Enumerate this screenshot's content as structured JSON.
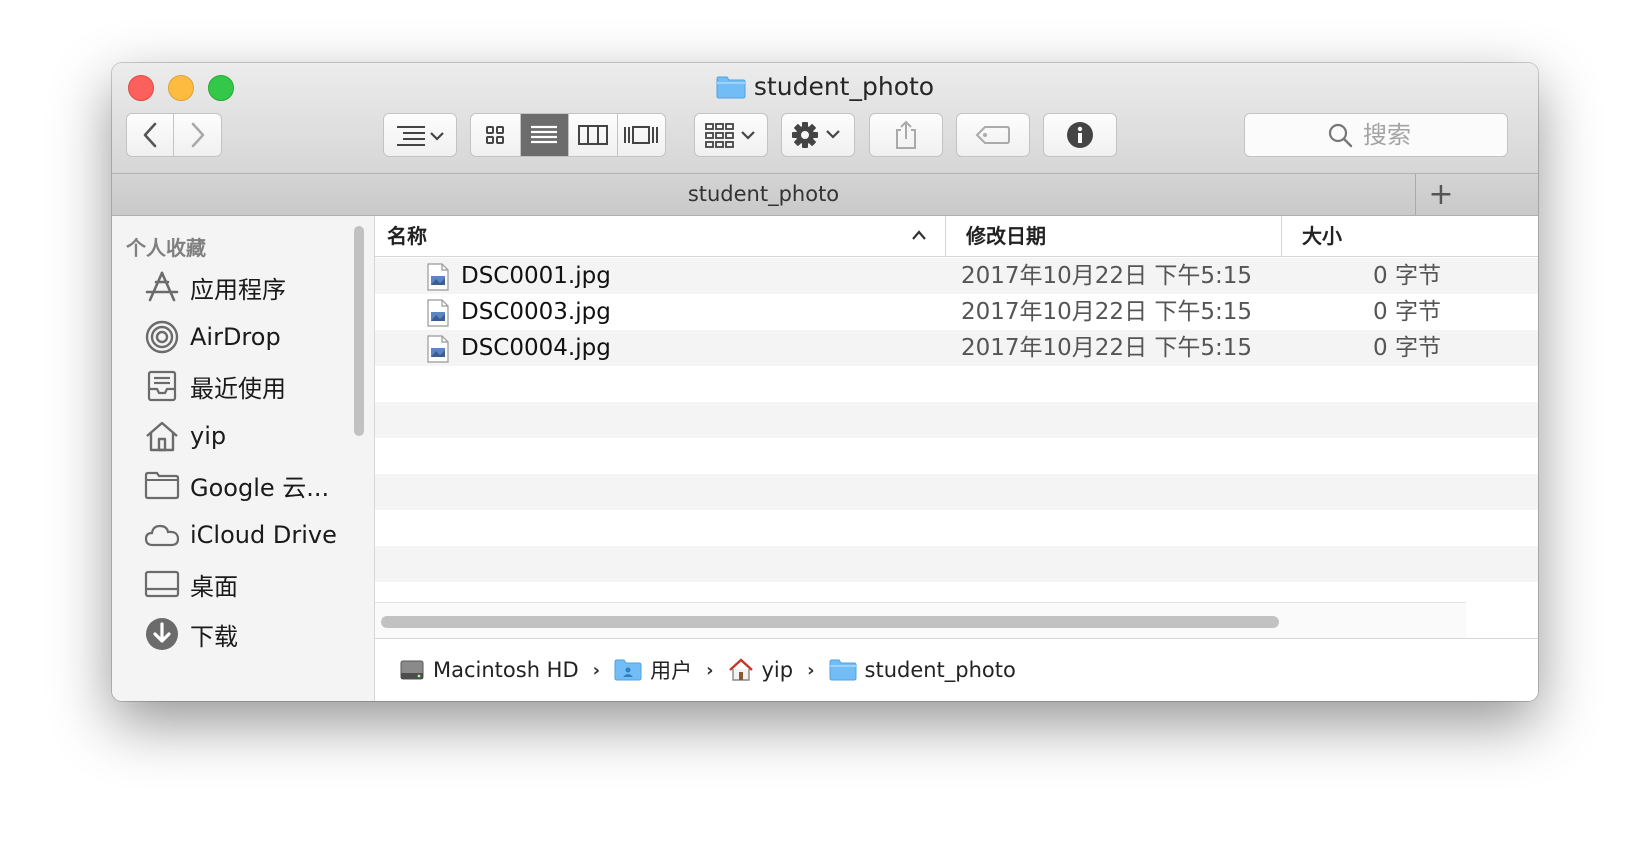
{
  "window": {
    "title": "student_photo"
  },
  "toolbar": {
    "search_placeholder": "搜索"
  },
  "tabbar": {
    "title": "student_photo",
    "add_label": "+"
  },
  "sidebar": {
    "heading": "个人收藏",
    "items": [
      {
        "label": "应用程序",
        "icon": "applications-icon"
      },
      {
        "label": "AirDrop",
        "icon": "airdrop-icon"
      },
      {
        "label": "最近使用",
        "icon": "recents-icon"
      },
      {
        "label": "yip",
        "icon": "home-icon"
      },
      {
        "label": "Google 云...",
        "icon": "folder-icon"
      },
      {
        "label": "iCloud Drive",
        "icon": "cloud-icon"
      },
      {
        "label": "桌面",
        "icon": "desktop-icon"
      },
      {
        "label": "下载",
        "icon": "download-icon"
      }
    ]
  },
  "columns": {
    "name": "名称",
    "date": "修改日期",
    "size": "大小",
    "sort_indicator": "^"
  },
  "files": [
    {
      "name": "DSC0001.jpg",
      "date": "2017年10月22日 下午5:15",
      "size": "0 字节"
    },
    {
      "name": "DSC0003.jpg",
      "date": "2017年10月22日 下午5:15",
      "size": "0 字节"
    },
    {
      "name": "DSC0004.jpg",
      "date": "2017年10月22日 下午5:15",
      "size": "0 字节"
    }
  ],
  "pathbar": {
    "segments": [
      {
        "label": "Macintosh HD",
        "icon": "hard-drive-icon"
      },
      {
        "label": "用户",
        "icon": "users-folder-icon"
      },
      {
        "label": "yip",
        "icon": "home-icon"
      },
      {
        "label": "student_photo",
        "icon": "folder-icon"
      }
    ],
    "separator": "›"
  },
  "colors": {
    "close": "#fc605c",
    "minimize": "#fdbc40",
    "maximize": "#34c84a",
    "folder_blue": "#6cb6f2",
    "active_segment": "#6c6c6c"
  }
}
